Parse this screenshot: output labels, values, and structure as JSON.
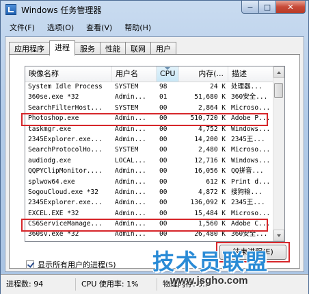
{
  "window": {
    "title": "Windows 任务管理器",
    "controls": {
      "minimize": "−",
      "maximize": "□",
      "close": "✕"
    }
  },
  "menu": [
    "文件(F)",
    "选项(O)",
    "查看(V)",
    "帮助(H)"
  ],
  "tabs": [
    "应用程序",
    "进程",
    "服务",
    "性能",
    "联网",
    "用户"
  ],
  "active_tab": "进程",
  "columns": [
    "映像名称",
    "用户名",
    "CPU",
    "内存(...",
    "描述"
  ],
  "processes": [
    {
      "name": "System Idle Process",
      "user": "SYSTEM",
      "cpu": "98",
      "mem": "24 K",
      "desc": "处理器..."
    },
    {
      "name": "360se.exe *32",
      "user": "Admin...",
      "cpu": "01",
      "mem": "51,680 K",
      "desc": "360安全..."
    },
    {
      "name": "SearchFilterHost...",
      "user": "SYSTEM",
      "cpu": "00",
      "mem": "2,864 K",
      "desc": "Microso..."
    },
    {
      "name": "Photoshop.exe",
      "user": "Admin...",
      "cpu": "00",
      "mem": "510,720 K",
      "desc": "Adobe P..."
    },
    {
      "name": "taskmgr.exe",
      "user": "Admin...",
      "cpu": "00",
      "mem": "4,752 K",
      "desc": "Windows..."
    },
    {
      "name": "2345Explorer.exe...",
      "user": "Admin...",
      "cpu": "00",
      "mem": "14,200 K",
      "desc": "2345王..."
    },
    {
      "name": "SearchProtocolHo...",
      "user": "SYSTEM",
      "cpu": "00",
      "mem": "2,480 K",
      "desc": "Microso..."
    },
    {
      "name": "audiodg.exe",
      "user": "LOCAL...",
      "cpu": "00",
      "mem": "12,716 K",
      "desc": "Windows..."
    },
    {
      "name": "QQPYClipMonitor....",
      "user": "Admin...",
      "cpu": "00",
      "mem": "16,056 K",
      "desc": "QQ拼音..."
    },
    {
      "name": "splwow64.exe",
      "user": "Admin...",
      "cpu": "00",
      "mem": "612 K",
      "desc": "Print d..."
    },
    {
      "name": "SogouCloud.exe *32",
      "user": "Admin...",
      "cpu": "00",
      "mem": "4,872 K",
      "desc": "搜狗输..."
    },
    {
      "name": "2345Explorer.exe...",
      "user": "Admin...",
      "cpu": "00",
      "mem": "136,092 K",
      "desc": "2345王..."
    },
    {
      "name": "EXCEL.EXE *32",
      "user": "Admin...",
      "cpu": "00",
      "mem": "15,484 K",
      "desc": "Microso..."
    },
    {
      "name": "CS6ServiceManage...",
      "user": "Admin...",
      "cpu": "00",
      "mem": "1,560 K",
      "desc": "Adobe C..."
    },
    {
      "name": "360sv.exe *32",
      "user": "Admin...",
      "cpu": "00",
      "mem": "26,480 K",
      "desc": "360安全..."
    }
  ],
  "show_all_users_label": "显示所有用户的进程(S)",
  "end_process_label": "结束进程(E)",
  "status": {
    "processes": "进程数: 94",
    "cpu": "CPU 使用率: 1%",
    "memory": "物理内存: 5..."
  },
  "watermark": {
    "main": "技术员联盟",
    "url": "www.jsgho.com"
  },
  "colors": {
    "highlight": "#d6262a",
    "title_bar": "#b2cbe8",
    "watermark": "#2a8bd6"
  }
}
